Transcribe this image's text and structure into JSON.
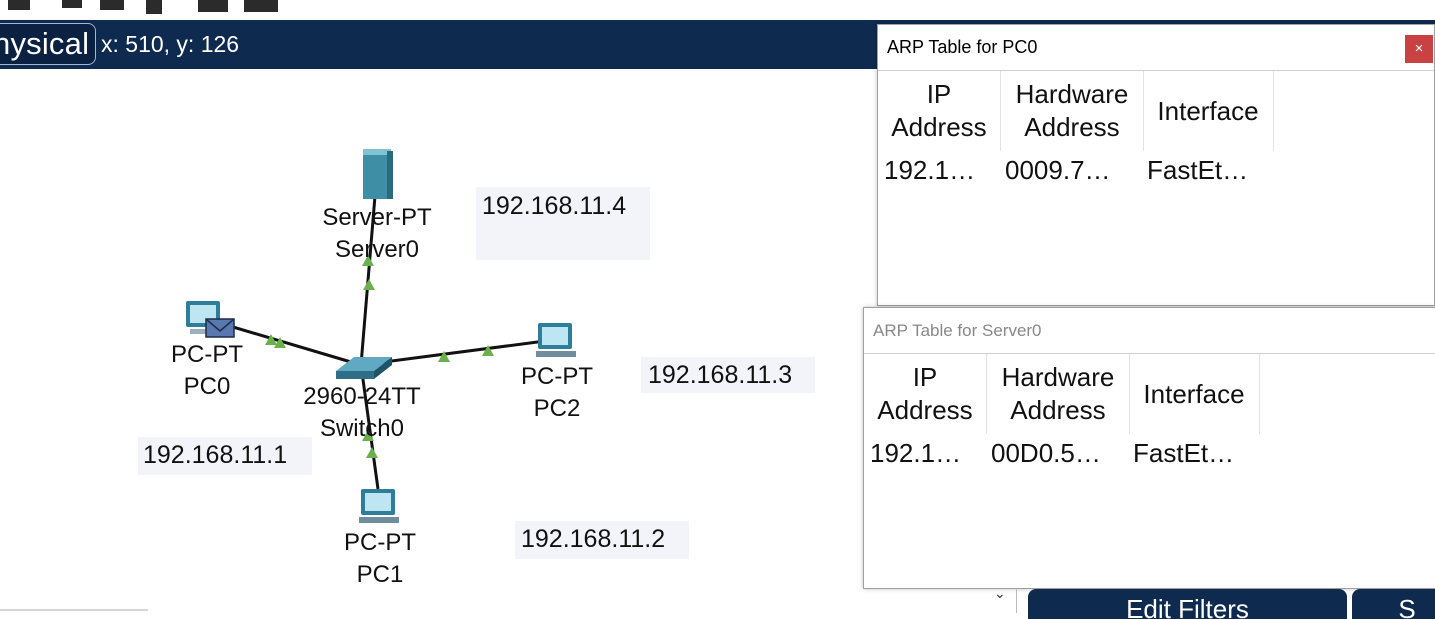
{
  "topbar": {
    "mode_label": "hysical",
    "coords": "x: 510, y: 126"
  },
  "devices": {
    "server0": {
      "type": "Server-PT",
      "name": "Server0"
    },
    "pc0": {
      "type": "PC-PT",
      "name": "PC0"
    },
    "switch0": {
      "type": "2960-24TT",
      "name": "Switch0"
    },
    "pc2": {
      "type": "PC-PT",
      "name": "PC2"
    },
    "pc1": {
      "type": "PC-PT",
      "name": "PC1"
    }
  },
  "ip_notes": {
    "server": "192.168.11.4",
    "pc2": "192.168.11.3",
    "pc0": "192.168.11.1",
    "pc1": "192.168.11.2"
  },
  "arp_pc0": {
    "title": "ARP Table for PC0",
    "close": "×",
    "headers": [
      "IP Address",
      "Hardware Address",
      "Interface"
    ],
    "row": [
      "192.1…",
      "0009.7…",
      "FastEt…"
    ]
  },
  "arp_server0": {
    "title": "ARP Table for Server0",
    "headers": [
      "IP Address",
      "Hardware Address",
      "Interface"
    ],
    "row": [
      "192.1…",
      "00D0.5…",
      "FastEt…"
    ]
  },
  "bottom": {
    "edit_filters": "Edit Filters",
    "next_btn": "S",
    "scroll_arrow": "⌄"
  },
  "colors": {
    "topbar": "#0f2a4f",
    "link": "#111111",
    "link_up": "#6ab04c",
    "close": "#c94141"
  }
}
